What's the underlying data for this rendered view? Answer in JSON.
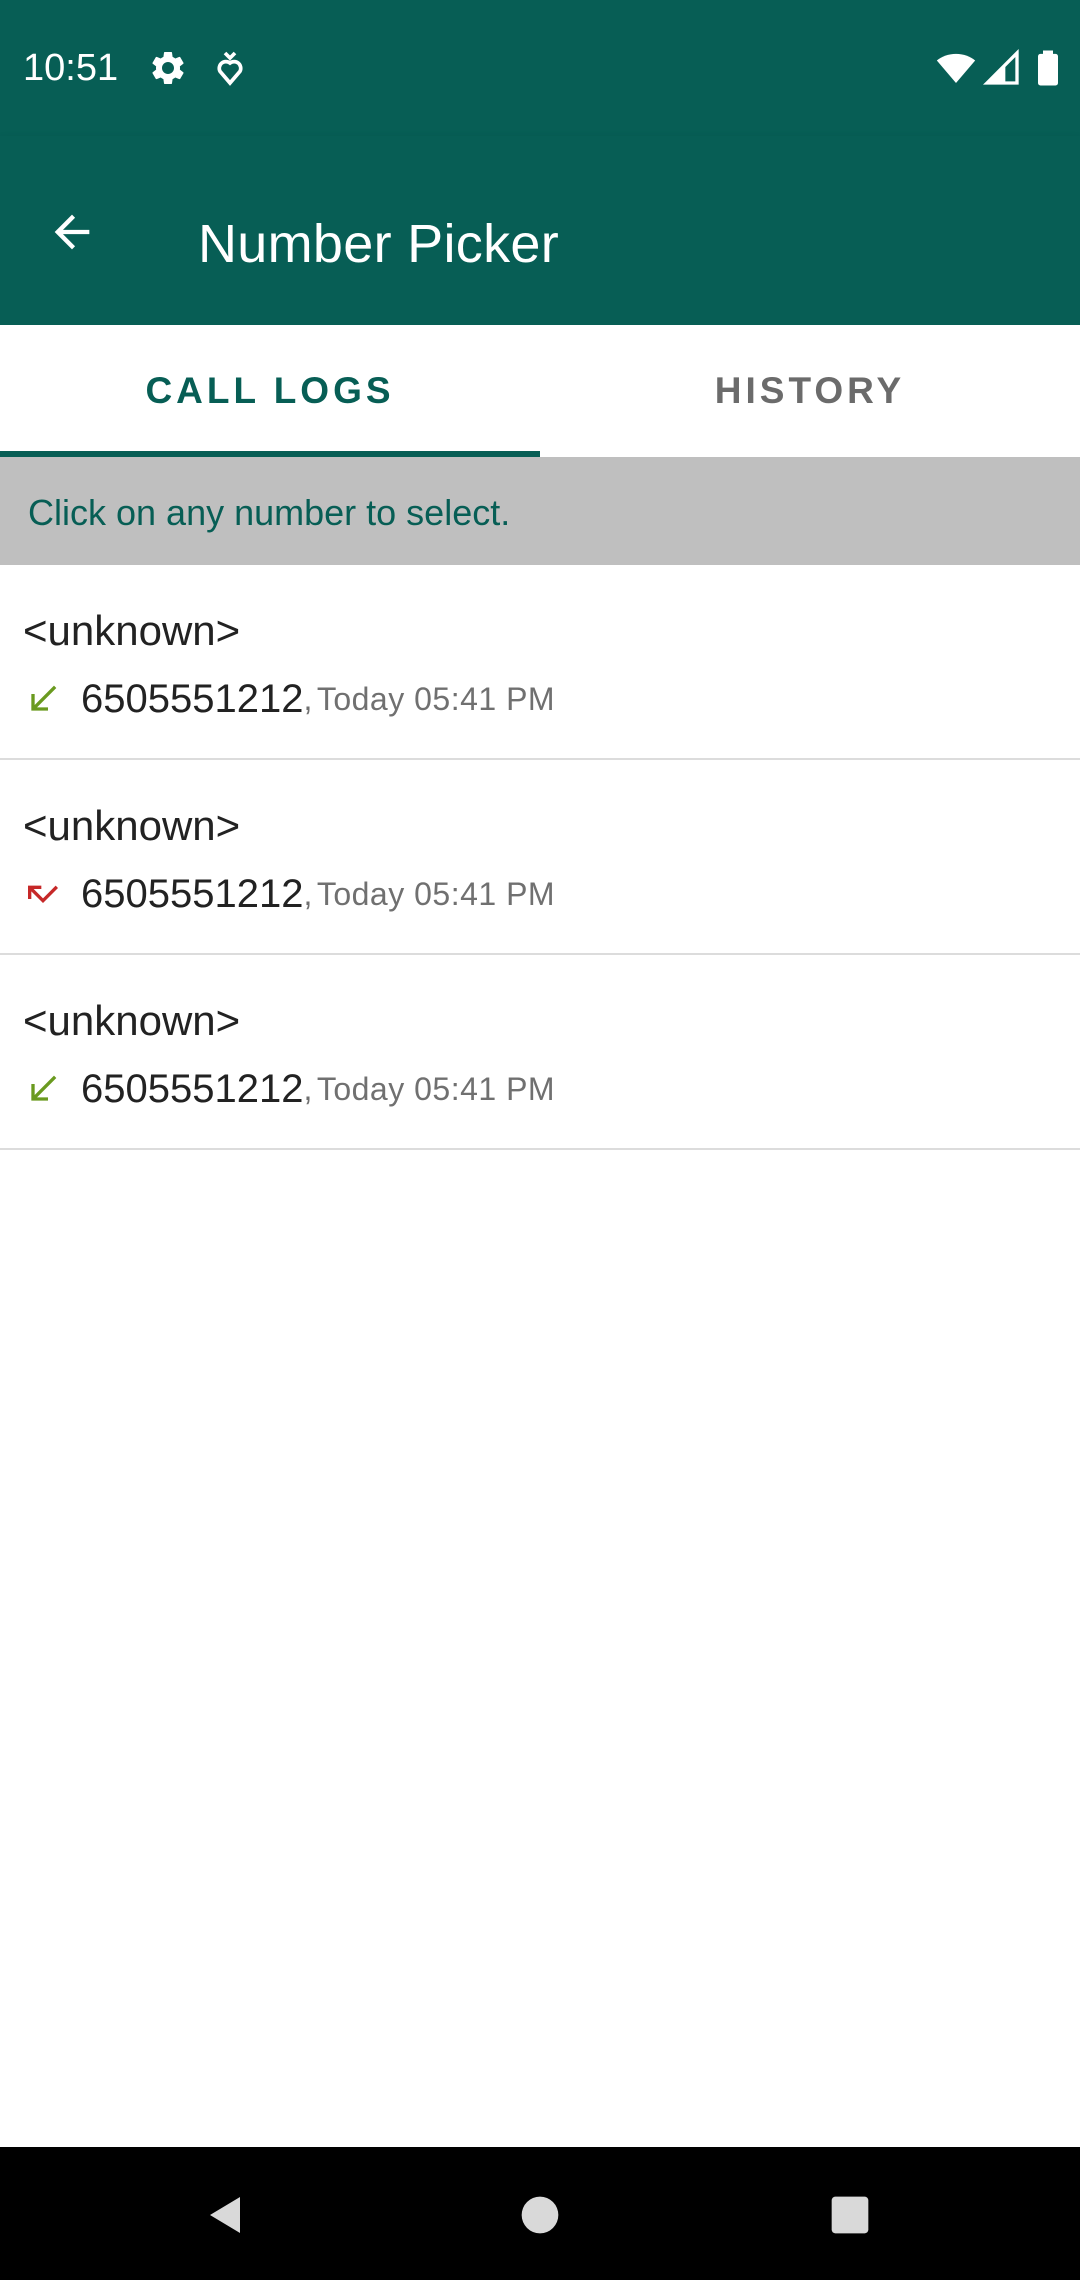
{
  "status_bar": {
    "time": "10:51",
    "icons": [
      "settings-icon",
      "location-icon",
      "wifi-icon",
      "signal-icon",
      "battery-icon"
    ]
  },
  "app_bar": {
    "title": "Number Picker",
    "back_icon": "back-arrow-icon"
  },
  "tabs": [
    {
      "label": "CALL LOGS",
      "active": true
    },
    {
      "label": "HISTORY",
      "active": false
    }
  ],
  "hint": "Click on any number to select.",
  "call_logs": [
    {
      "name": "<unknown>",
      "number": "6505551212",
      "separator": ",",
      "time": "Today 05:41 PM",
      "type": "incoming",
      "icon": "incoming-call-icon"
    },
    {
      "name": "<unknown>",
      "number": "6505551212",
      "separator": ",",
      "time": "Today 05:41 PM",
      "type": "missed",
      "icon": "missed-call-icon"
    },
    {
      "name": "<unknown>",
      "number": "6505551212",
      "separator": ",",
      "time": "Today 05:41 PM",
      "type": "incoming",
      "icon": "incoming-call-icon"
    }
  ],
  "colors": {
    "primary": "#075e55",
    "hint_background": "#bfbfbf",
    "incoming": "#6a9a1f",
    "missed": "#c62828"
  },
  "nav_bar": {
    "icons": [
      "back-triangle-icon",
      "home-circle-icon",
      "recents-square-icon"
    ]
  }
}
